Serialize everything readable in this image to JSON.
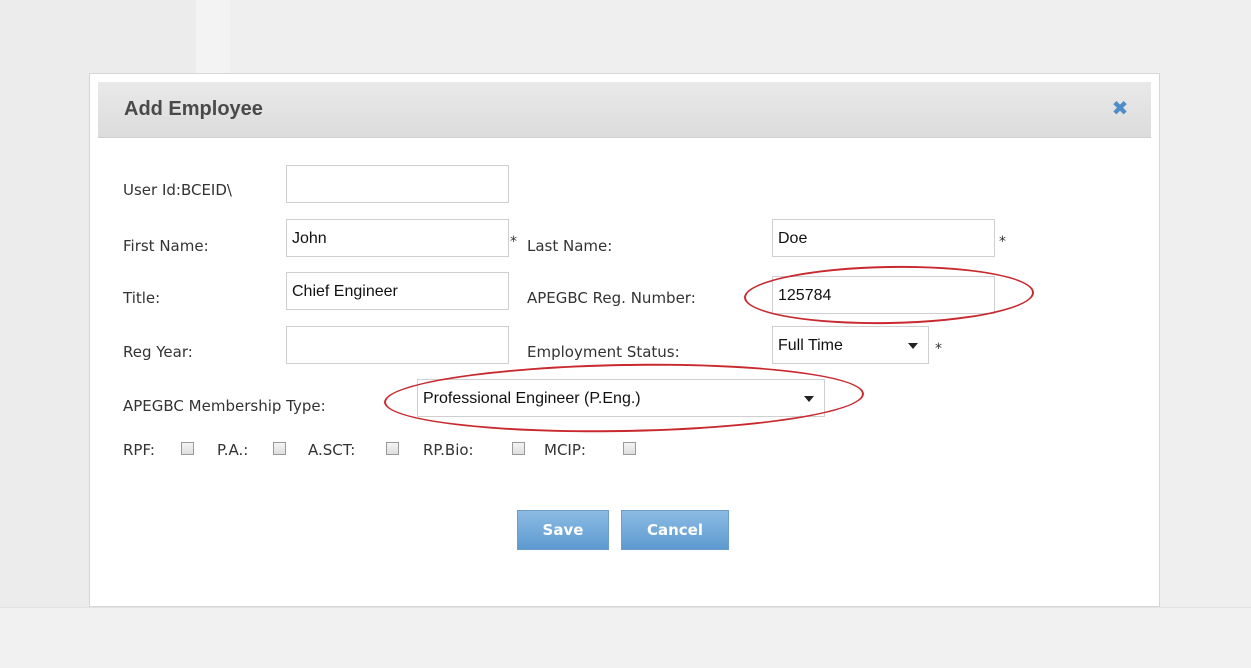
{
  "dialog": {
    "title": "Add Employee"
  },
  "form": {
    "user_id_label": "User Id:BCEID\\",
    "user_id_value": "",
    "first_name_label": "First Name:",
    "first_name_value": "John",
    "last_name_label": "Last Name:",
    "last_name_value": "Doe",
    "title_label": "Title:",
    "title_value": "Chief Engineer",
    "reg_number_label": "APEGBC Reg. Number:",
    "reg_number_value": "125784",
    "reg_year_label": "Reg Year:",
    "reg_year_value": "",
    "employment_status_label": "Employment Status:",
    "employment_status_value": "Full Time",
    "membership_type_label": "APEGBC Membership Type:",
    "membership_type_value": "Professional Engineer (P.Eng.)",
    "required_marker": "*"
  },
  "checkboxes": [
    {
      "label": "RPF:",
      "checked": false
    },
    {
      "label": "P.A.:",
      "checked": false
    },
    {
      "label": "A.SCT:",
      "checked": false
    },
    {
      "label": "RP.Bio:",
      "checked": false
    },
    {
      "label": "MCIP:",
      "checked": false
    }
  ],
  "buttons": {
    "save": "Save",
    "cancel": "Cancel"
  },
  "icons": {
    "close": "close-icon",
    "dropdown": "chevron-down-icon"
  },
  "colors": {
    "accent": "#5d9ad0",
    "highlight": "#c8292e",
    "close_icon": "#4f8dc9"
  }
}
